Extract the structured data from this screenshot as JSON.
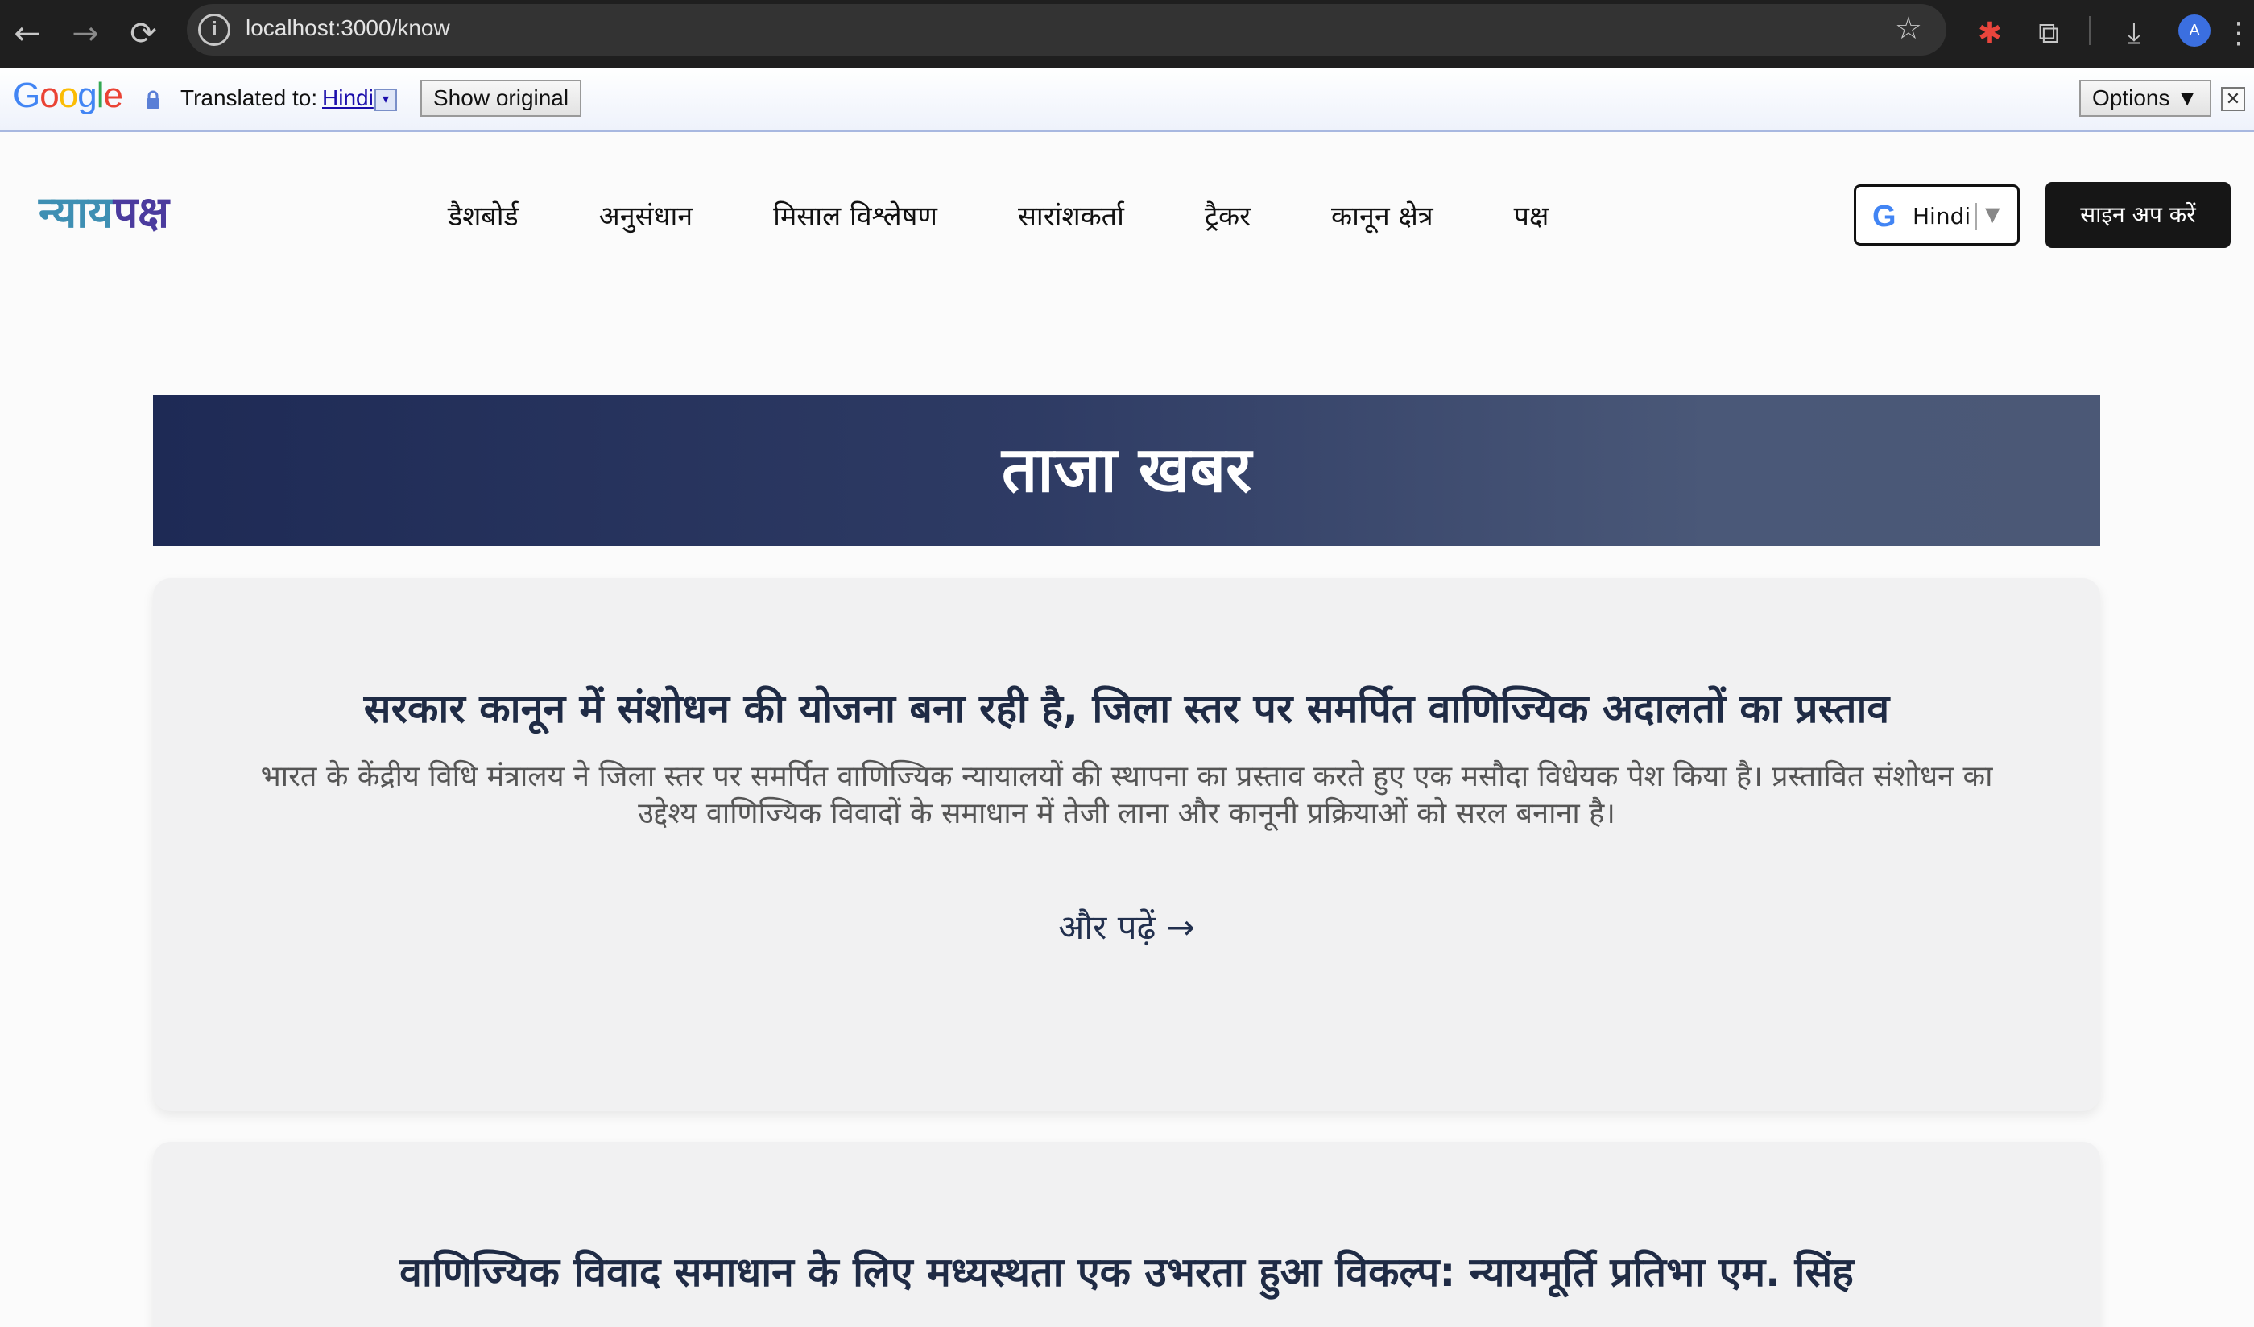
{
  "browser": {
    "url": "localhost:3000/know",
    "back_glyph": "←",
    "forward_glyph": "→",
    "reload_glyph": "⟳",
    "info_glyph": "i",
    "star_glyph": "☆",
    "ext_glyph": "✱",
    "puzzle_glyph": "⧉",
    "download_glyph": "⤓",
    "avatar_letter": "A",
    "menu_glyph": "⋮"
  },
  "translate_bar": {
    "logo": [
      "G",
      "o",
      "o",
      "g",
      "l",
      "e"
    ],
    "label": "Translated to:",
    "language": "Hindi",
    "dropdown_glyph": "▾",
    "show_original": "Show original",
    "options": "Options ▼",
    "close_glyph": "✕"
  },
  "header": {
    "brand_part1": "न्याय",
    "brand_part2": "पक्ष",
    "nav": [
      "डैशबोर्ड",
      "अनुसंधान",
      "मिसाल विश्लेषण",
      "सारांशकर्ता",
      "ट्रैकर",
      "कानून क्षेत्र",
      "पक्ष"
    ],
    "language_select": {
      "g_icon": "G",
      "label": "Hindi",
      "arrow": "▼"
    },
    "signup": "साइन अप करें"
  },
  "banner": {
    "title": "ताजा खबर"
  },
  "news": [
    {
      "title": "सरकार कानून में संशोधन की योजना बना रही है, जिला स्तर पर समर्पित वाणिज्यिक अदालतों का प्रस्ताव",
      "description": "भारत के केंद्रीय विधि मंत्रालय ने जिला स्तर पर समर्पित वाणिज्यिक न्यायालयों की स्थापना का प्रस्ताव करते हुए एक मसौदा विधेयक पेश किया है। प्रस्तावित संशोधन का उद्देश्य वाणिज्यिक विवादों के समाधान में तेजी लाना और कानूनी प्रक्रियाओं को सरल बनाना है।",
      "read_more": "और पढ़ें →"
    },
    {
      "title": "वाणिज्यिक विवाद समाधान के लिए मध्यस्थता एक उभरता हुआ विकल्प: न्यायमूर्ति प्रतिभा एम. सिंह"
    }
  ],
  "colors": {
    "brand_teal": "#3e8fb3",
    "brand_purple": "#4b3b9e",
    "banner_start": "#1e2a55",
    "banner_end": "#4b5876",
    "card_bg": "#f1f1f2",
    "title_text": "#1f2b45"
  }
}
